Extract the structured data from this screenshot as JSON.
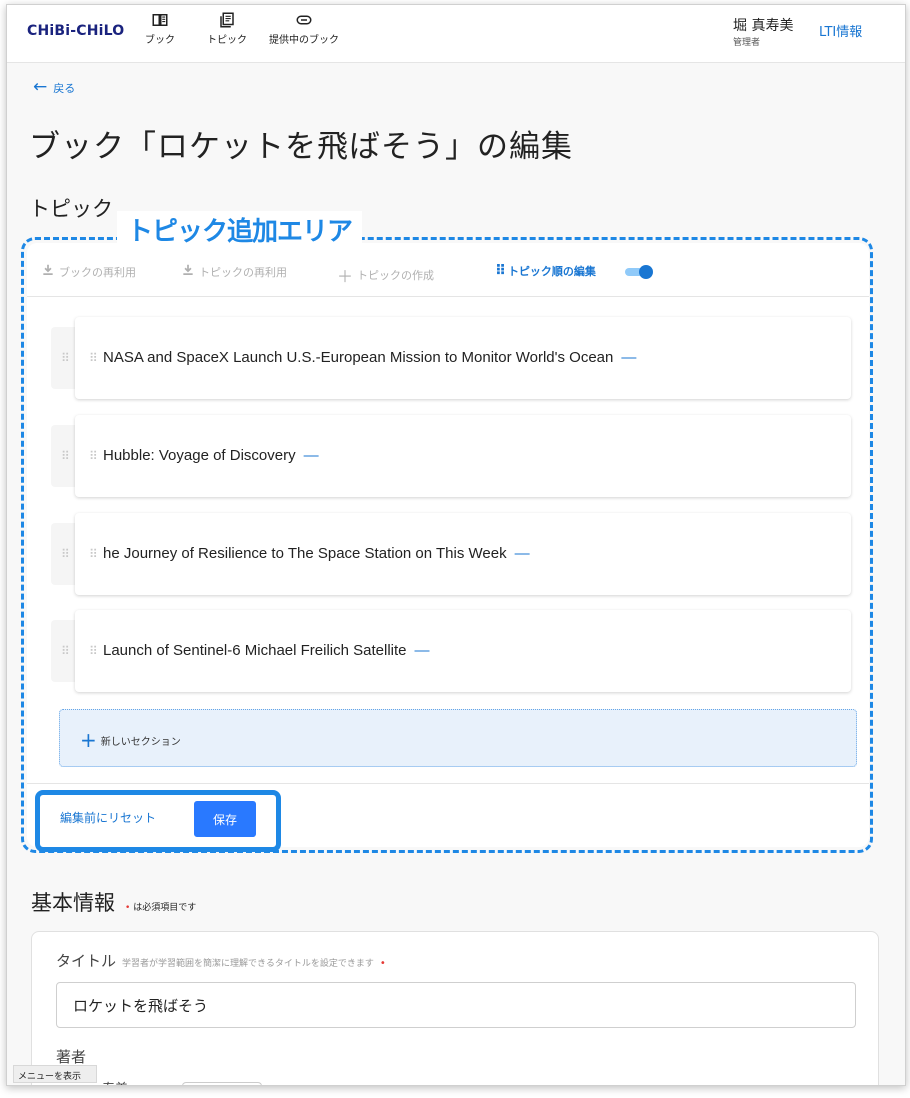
{
  "header": {
    "logo": "CHiBi-CHiLO",
    "nav": [
      {
        "label": "ブック",
        "icon": "book-icon"
      },
      {
        "label": "トピック",
        "icon": "topic-icon"
      },
      {
        "label": "提供中のブック",
        "icon": "link-icon"
      }
    ],
    "user_name": "堀 真寿美",
    "user_role": "管理者",
    "lti_link": "LTI情報"
  },
  "back_label": "戻る",
  "page_title": "ブック「ロケットを飛ばそう」の編集",
  "topics_section": {
    "title": "トピック",
    "annotation_label": "トピック追加エリア",
    "toolbar": {
      "reuse_book": "ブックの再利用",
      "reuse_topic": "トピックの再利用",
      "create_topic": "トピックの作成",
      "edit_order": "トピック順の編集",
      "edit_order_enabled": true
    },
    "topics": [
      {
        "title": "NASA and SpaceX Launch U.S.-European Mission to Monitor World's Ocean"
      },
      {
        "title": "Hubble: Voyage of Discovery"
      },
      {
        "title": "he Journey of Resilience to The Space Station on This Week"
      },
      {
        "title": "Launch of Sentinel-6 Michael Freilich Satellite"
      }
    ],
    "new_section": "新しいセクション",
    "reset_button": "編集前にリセット",
    "save_button": "保存"
  },
  "basic_info": {
    "title": "基本情報",
    "required_note": "は必須項目です",
    "title_field_label": "タイトル",
    "title_field_hint": "学習者が学習範囲を簡潔に理解できるタイトルを設定できます",
    "title_value": "ロケットを飛ばそう",
    "author_label": "著者",
    "author_value_partial": "寿美"
  },
  "menu_toggle": "メニューを表示",
  "colors": {
    "accent": "#1976d2",
    "annotation": "#1e88e5",
    "save": "#2979ff",
    "required": "#e53935"
  }
}
